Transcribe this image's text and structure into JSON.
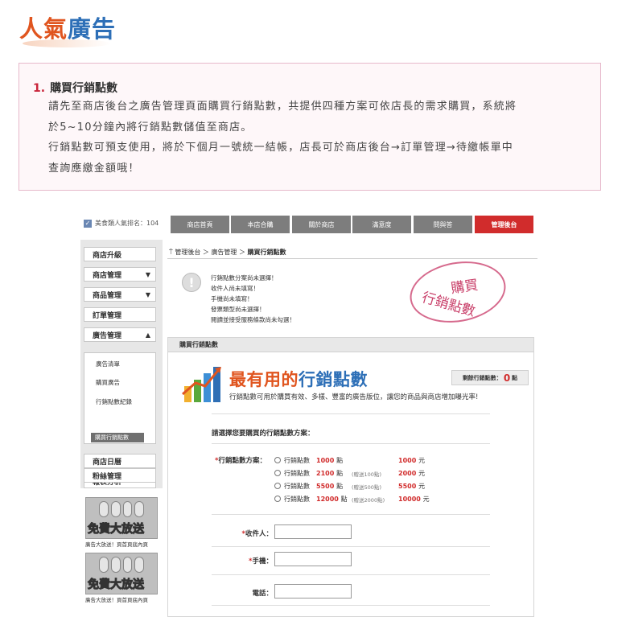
{
  "heading": {
    "left": "人氣",
    "right": "廣告"
  },
  "info": {
    "num": "1.",
    "title": "購買行銷點數",
    "lines": [
      "請先至商店後台之廣告管理頁面購買行銷點數，共提供四種方案可依店長的需求購買，系統將",
      "於5~10分鐘內將行銷點數儲值至商店。",
      "行銷點數可預支使用，將於下個月一號統一結帳，店長可於商店後台→訂單管理→待繳帳單中",
      "查詢應繳金額哦！"
    ]
  },
  "shot": {
    "member": "美食類人氣排名：104",
    "tabs": [
      "商店首頁",
      "本店合購",
      "關於商店",
      "滿意度",
      "問與答",
      "管理後台"
    ],
    "sidebar": {
      "items": [
        {
          "label": "商店升級",
          "arrow": ""
        },
        {
          "label": "商店管理",
          "arrow": "▼"
        },
        {
          "label": "商品管理",
          "arrow": "▼"
        },
        {
          "label": "訂單管理",
          "arrow": ""
        },
        {
          "label": "廣告管理",
          "arrow": "▲"
        }
      ],
      "sub_items": [
        "廣告清單",
        "購買廣告",
        "行銷點數紀錄"
      ],
      "sub_active": "購買行銷點數",
      "items_after": [
        "商店日曆",
        "報表分析",
        "粉絲管理"
      ]
    },
    "promos": [
      {
        "text": "免費大放送",
        "caption": "廣告大放送！頁首頁底內頁"
      },
      {
        "text": "免費大放送",
        "caption": "廣告大放送！頁首頁底內頁"
      }
    ],
    "breadcrumb": {
      "a": "管理後台",
      "sep1": "＞",
      "b": "廣告管理",
      "sep2": "＞",
      "c": "購買行銷點數"
    },
    "warnings": [
      "行銷點數分案尚未選擇！",
      "收件人尚未填寫！",
      "手機尚未填寫！",
      "發票類型尚未選擇！",
      "閱讀並接受服務條款尚未勾選！"
    ],
    "stamp": {
      "line1": "購買",
      "line2": "行銷點數"
    },
    "panel": {
      "title": "購買行銷點數",
      "big1": "最有用的",
      "big2": "行銷點數",
      "remain_label": "剩餘行銷點數：",
      "remain_value": "0",
      "remain_unit": "點",
      "desc": "行銷點數可用於購買有效、多樣、豐富的廣告版位，讓您的商品與商店增加曝光率!",
      "question": "請選擇您要購買的行銷點數方案：",
      "plan_label_req": "*",
      "plan_label": "行銷點數方案：",
      "plans": [
        {
          "name": "行銷點數",
          "points": "1000",
          "pt_unit": "點",
          "bonus": "",
          "price": "1000",
          "currency": "元"
        },
        {
          "name": "行銷點數",
          "points": "2100",
          "pt_unit": "點",
          "bonus": "(贈送100點)",
          "price": "2000",
          "currency": "元"
        },
        {
          "name": "行銷點數",
          "points": "5500",
          "pt_unit": "點",
          "bonus": "(贈送500點)",
          "price": "5500",
          "currency": "元"
        },
        {
          "name": "行銷點數",
          "points": "12000",
          "pt_unit": "點",
          "bonus": "(贈送2000點)",
          "price": "10000",
          "currency": "元"
        }
      ],
      "fields": [
        {
          "req": "*",
          "label": "收件人："
        },
        {
          "req": "*",
          "label": "手機："
        },
        {
          "req": "",
          "label": "電話："
        }
      ]
    }
  }
}
